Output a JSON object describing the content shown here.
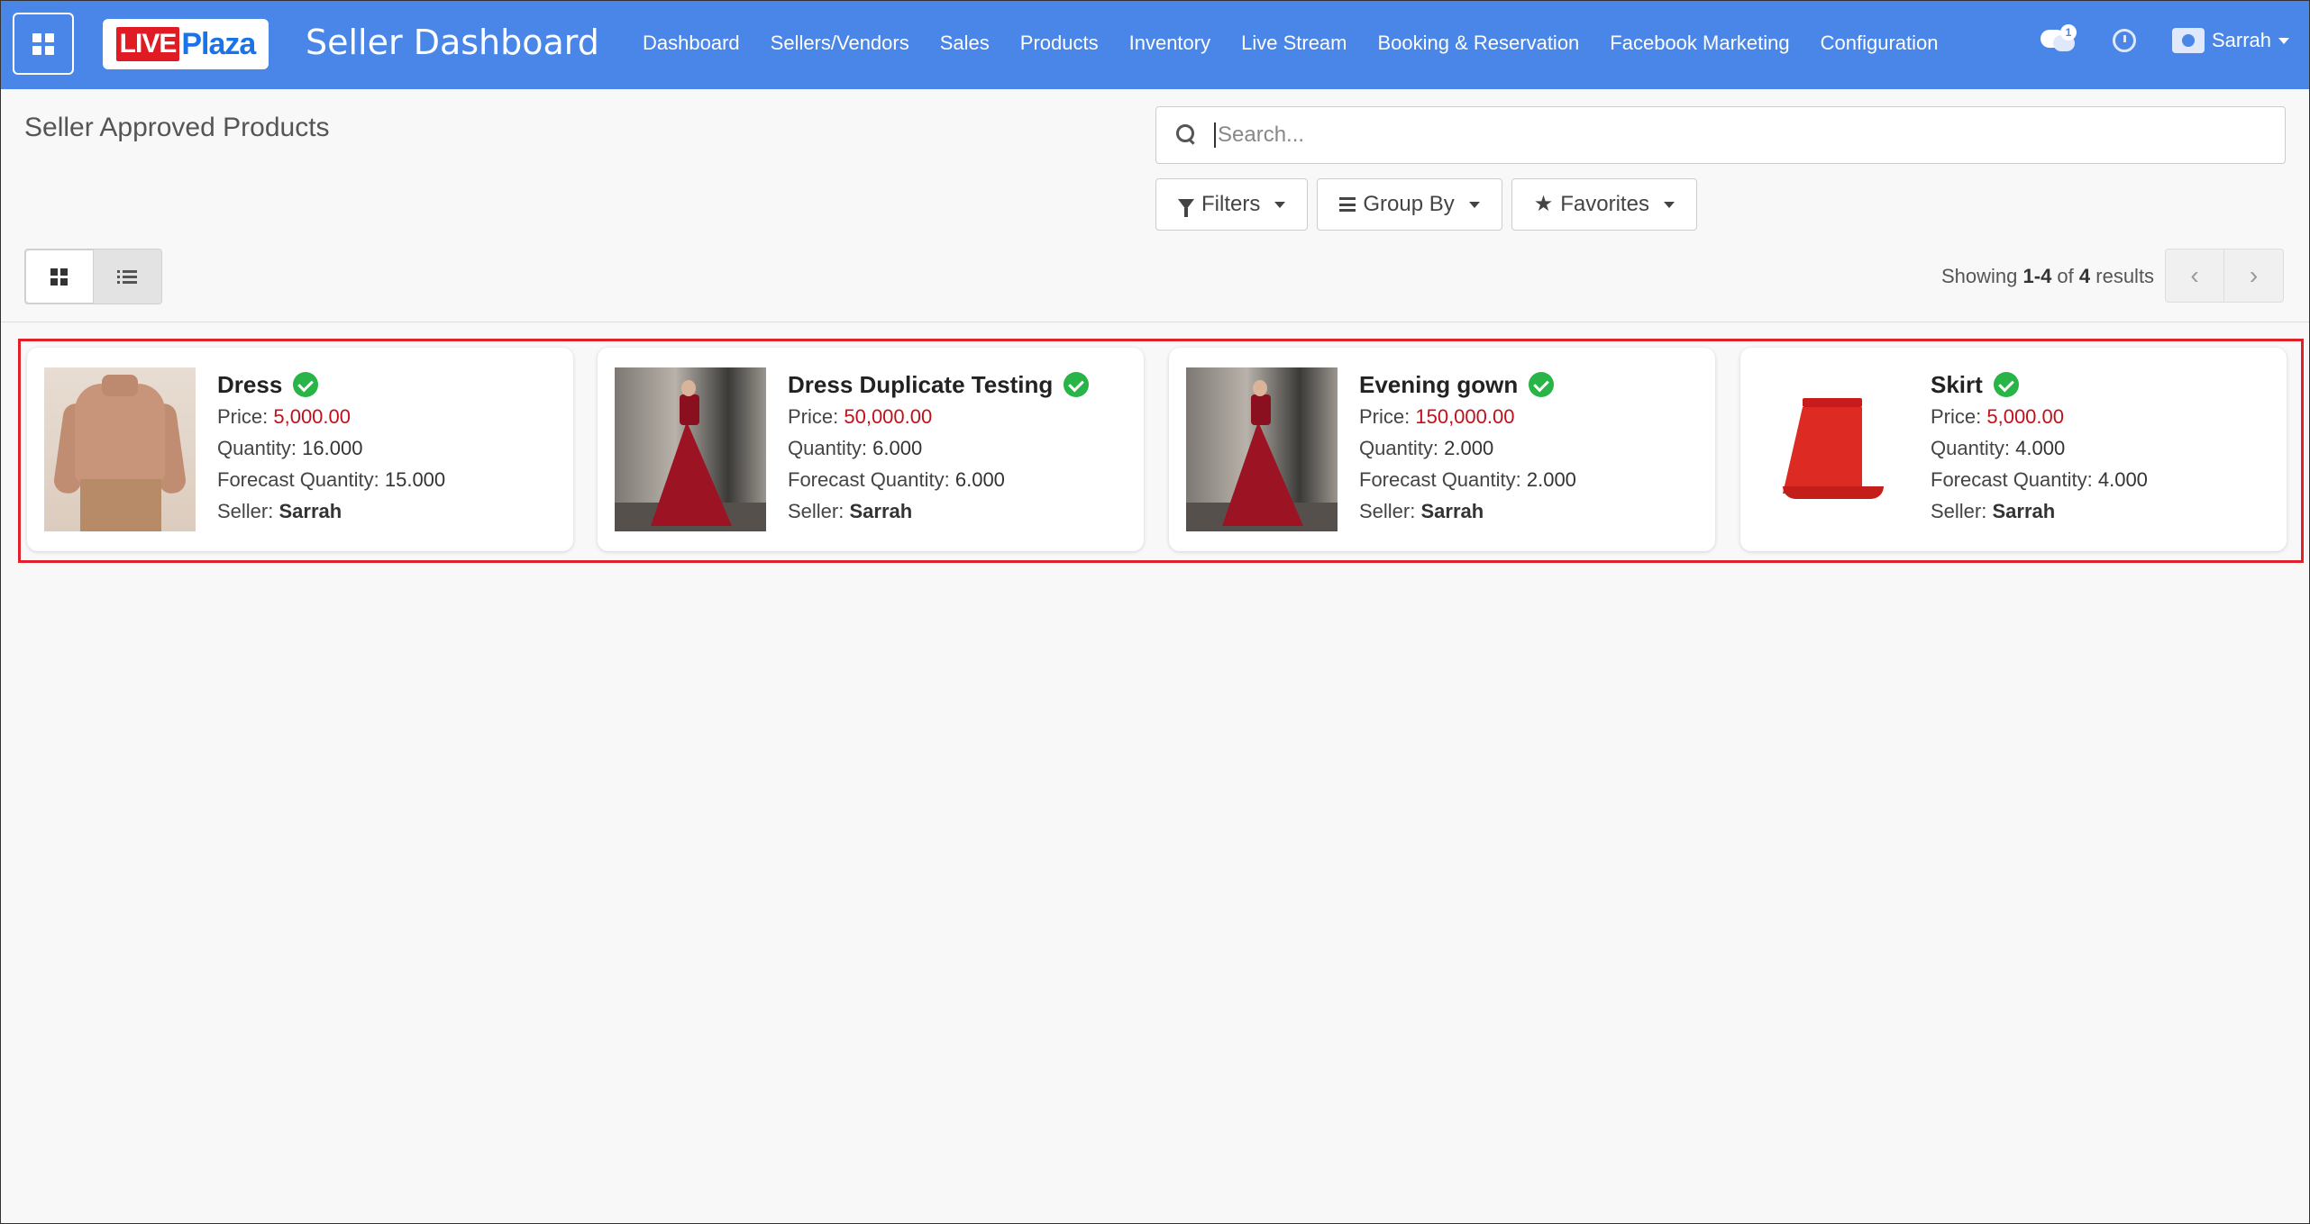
{
  "navbar": {
    "logo_live": "LIVE",
    "logo_plaza": "Plaza",
    "app_title": "Seller Dashboard",
    "menu": [
      "Dashboard",
      "Sellers/Vendors",
      "Sales",
      "Products",
      "Inventory",
      "Live Stream",
      "Booking & Reservation",
      "Facebook Marketing",
      "Configuration"
    ],
    "chat_badge": "1",
    "user_name": "Sarrah"
  },
  "control_panel": {
    "page_title": "Seller Approved Products",
    "search_placeholder": "Search...",
    "filters_label": "Filters",
    "groupby_label": "Group By",
    "favorites_label": "Favorites",
    "pager_prefix": "Showing ",
    "pager_range": "1-4",
    "pager_of": " of ",
    "pager_total": "4",
    "pager_suffix": " results"
  },
  "labels": {
    "price": "Price: ",
    "quantity": "Quantity: ",
    "forecast": "Forecast Quantity: ",
    "seller": "Seller: "
  },
  "products": [
    {
      "name": "Dress",
      "price": "5,000.00",
      "quantity": "16.000",
      "forecast": "15.000",
      "seller": "Sarrah",
      "image": "sweater"
    },
    {
      "name": "Dress Duplicate Testing",
      "price": "50,000.00",
      "quantity": "6.000",
      "forecast": "6.000",
      "seller": "Sarrah",
      "image": "gown"
    },
    {
      "name": "Evening gown",
      "price": "150,000.00",
      "quantity": "2.000",
      "forecast": "2.000",
      "seller": "Sarrah",
      "image": "gown"
    },
    {
      "name": "Skirt",
      "price": "5,000.00",
      "quantity": "4.000",
      "forecast": "4.000",
      "seller": "Sarrah",
      "image": "skirt"
    }
  ],
  "colors": {
    "navbar": "#4a86e8",
    "price": "#c0111a",
    "approved_check": "#28b446",
    "highlight_border": "#e0202a"
  }
}
